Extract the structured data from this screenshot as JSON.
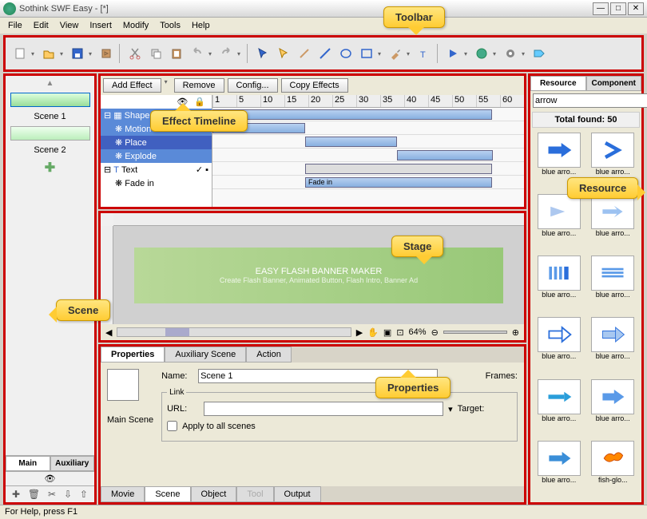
{
  "app": {
    "title": "Sothink SWF Easy - [*]"
  },
  "menu": [
    "File",
    "Edit",
    "View",
    "Insert",
    "Modify",
    "Tools",
    "Help"
  ],
  "timeline": {
    "buttons": {
      "add": "Add Effect",
      "remove": "Remove",
      "config": "Config...",
      "copy": "Copy Effects"
    },
    "ruler": [
      "1",
      "5",
      "10",
      "15",
      "20",
      "25",
      "30",
      "35",
      "40",
      "45",
      "50",
      "55",
      "60"
    ],
    "rows": {
      "shape": "Shape1",
      "motion": "Motion",
      "place": "Place",
      "explode": "Explode",
      "text": "Text",
      "fadein": "Fade in"
    },
    "bar_fadein": "Fade in"
  },
  "scenes": {
    "s1": "Scene 1",
    "s2": "Scene 2",
    "tab_main": "Main",
    "tab_aux": "Auxiliary"
  },
  "stage": {
    "banner_title": "EASY FLASH BANNER MAKER",
    "banner_sub": "Create Flash Banner, Animated Button, Flash Intro, Banner Ad",
    "zoom": "64%"
  },
  "props": {
    "tabs": {
      "properties": "Properties",
      "aux": "Auxiliary Scene",
      "action": "Action"
    },
    "main_scene": "Main Scene",
    "name_label": "Name:",
    "name_value": "Scene 1",
    "link_label": "Link",
    "url_label": "URL:",
    "target_label": "Target:",
    "apply": "Apply to all scenes",
    "frames_label": "Frames:",
    "btabs": {
      "movie": "Movie",
      "scene": "Scene",
      "object": "Object",
      "tool": "Tool",
      "output": "Output"
    }
  },
  "resource": {
    "tabs": {
      "res": "Resource",
      "comp": "Component"
    },
    "search": "arrow",
    "total": "Total found: 50",
    "items": [
      "blue arro...",
      "blue arro...",
      "blue arro...",
      "blue arro...",
      "blue arro...",
      "blue arro...",
      "blue arro...",
      "blue arro...",
      "blue arro...",
      "blue arro...",
      "blue arro...",
      "fish-glo..."
    ]
  },
  "statusbar": "For Help, press F1",
  "callouts": {
    "toolbar": "Toolbar",
    "timeline": "Effect Timeline",
    "stage": "Stage",
    "scene": "Scene",
    "props": "Properties",
    "resource": "Resource"
  }
}
